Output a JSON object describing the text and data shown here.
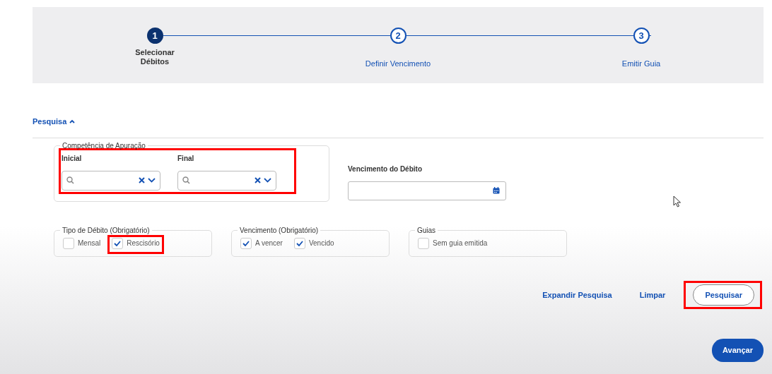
{
  "stepper": {
    "steps": [
      {
        "number": "1",
        "label": "Selecionar Débitos",
        "selected": true
      },
      {
        "number": "2",
        "label": "Definir Vencimento",
        "selected": false
      },
      {
        "number": "3",
        "label": "Emitir Guia",
        "selected": false
      }
    ]
  },
  "search_toggle": {
    "label": "Pesquisa",
    "expanded": true
  },
  "competencia": {
    "legend": "Competência de Apuração",
    "highlighted": true,
    "fields": [
      {
        "label": "Inicial"
      },
      {
        "label": "Final"
      }
    ]
  },
  "vencimento_debito": {
    "label": "Vencimento do Débito"
  },
  "groups": [
    {
      "legend": "Tipo de Débito (Obrigatório)",
      "options": [
        {
          "label": "Mensal",
          "checked": false,
          "highlighted": false
        },
        {
          "label": "Rescisório",
          "checked": true,
          "highlighted": true
        }
      ]
    },
    {
      "legend": "Vencimento (Obrigatório)",
      "options": [
        {
          "label": "A vencer",
          "checked": true,
          "highlighted": false
        },
        {
          "label": "Vencido",
          "checked": true,
          "highlighted": false
        }
      ]
    },
    {
      "legend": "Guias",
      "options": [
        {
          "label": "Sem guia emitida",
          "checked": false,
          "highlighted": false
        }
      ]
    }
  ],
  "actions": [
    {
      "label": "Expandir Pesquisa",
      "kind": "link",
      "highlighted": false
    },
    {
      "label": "Limpar",
      "kind": "link",
      "highlighted": false
    },
    {
      "label": "Pesquisar",
      "kind": "outline",
      "highlighted": true
    }
  ],
  "next_button": {
    "label": "Avançar"
  }
}
